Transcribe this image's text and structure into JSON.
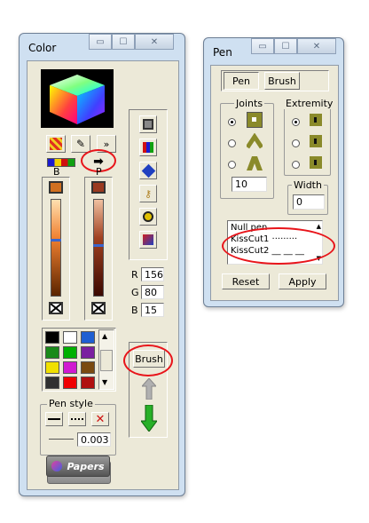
{
  "color_window": {
    "title": "Color",
    "caption": {
      "minimize": "▭",
      "maximize": "☐",
      "close": "✕"
    },
    "more_button": "»",
    "b_label": "B",
    "p_label": "P",
    "r_label": "R",
    "r_value": "156",
    "g_label": "G",
    "g_value": "80",
    "b2_label": "B",
    "b2_value": "15",
    "brush_button": "Brush",
    "pen_style_title": "Pen style",
    "pen_width_value": "0.003",
    "tools_button": "tools",
    "papers_button": "Papers",
    "palette": [
      "#000000",
      "#ffffff",
      "#1f5fd2",
      "#1a8a1a",
      "#00b000",
      "#7a1fa0",
      "#f0e000",
      "#d01ad0",
      "#7a4a10",
      "#303030",
      "#f00000",
      "#b01010"
    ]
  },
  "pen_window": {
    "title": "Pen",
    "caption": {
      "minimize": "▭",
      "maximize": "☐",
      "close": "✕"
    },
    "tab_pen": "Pen",
    "tab_brush": "Brush",
    "joints_title": "Joints",
    "joints_value": "10",
    "extremity_title": "Extremity",
    "width_title": "Width",
    "width_value": "0",
    "list_items": [
      "Null pen",
      "KissCut1 ·········",
      "KissCut2 __ __ __"
    ],
    "reset_button": "Reset",
    "apply_button": "Apply"
  },
  "colors": {
    "highlight": "#e8141a",
    "title_bg": "#cfe0f1",
    "client_bg": "#ece9d8"
  }
}
